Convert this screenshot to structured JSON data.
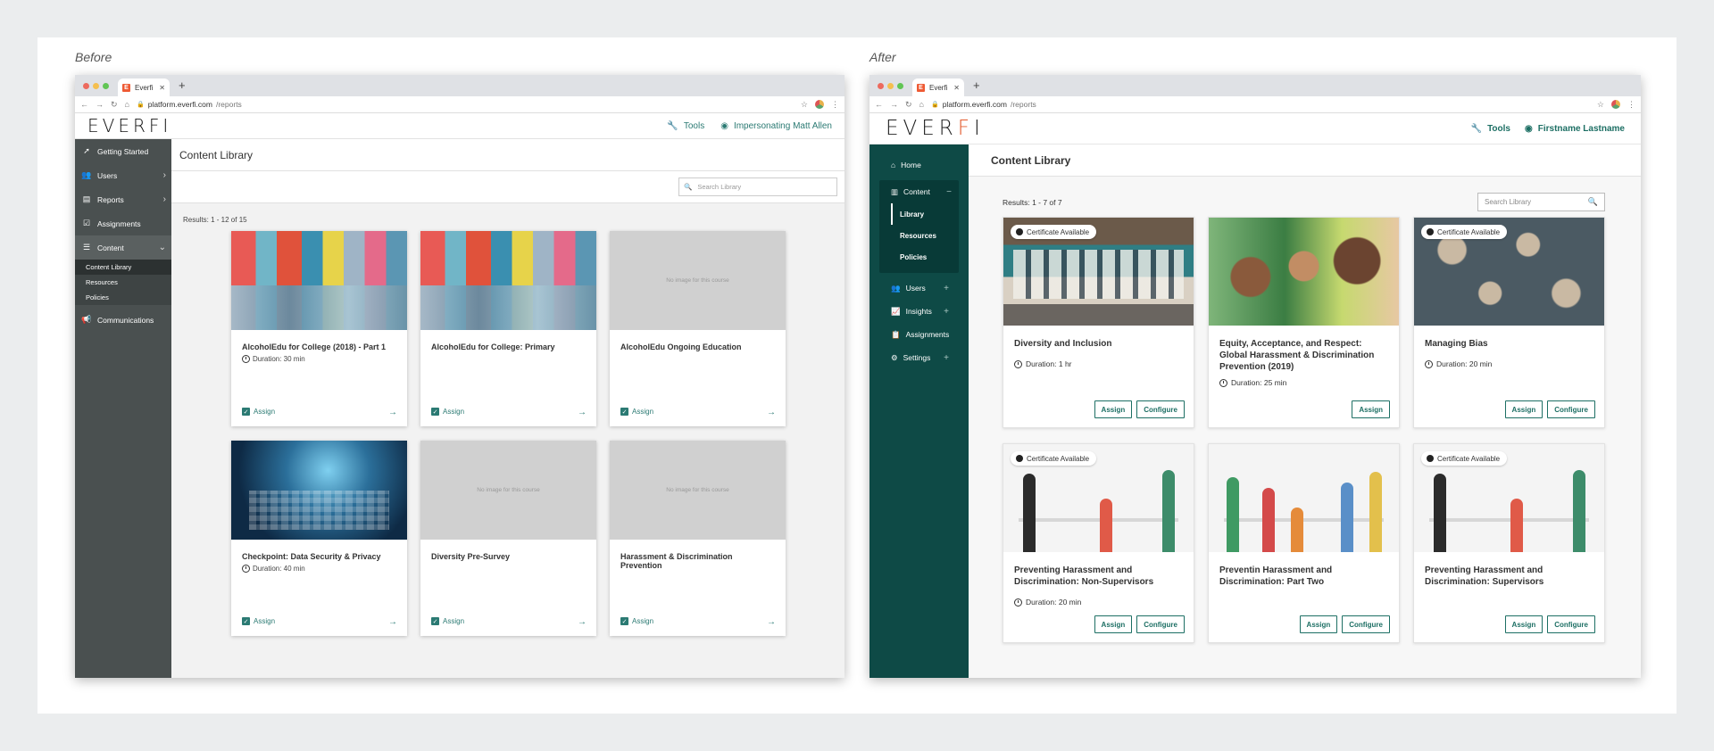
{
  "captions": {
    "before": "Before",
    "after": "After"
  },
  "browser": {
    "tab_label": "Everfi",
    "favicon_letter": "E",
    "url_host": "platform.everfi.com",
    "url_path": "/reports"
  },
  "before": {
    "logo_text": "EVERFI",
    "header": {
      "tools": "Tools",
      "user": "Impersonating Matt Allen"
    },
    "sidebar": {
      "items": [
        {
          "label": "Getting Started",
          "icon": "rocket-icon"
        },
        {
          "label": "Users",
          "icon": "users-icon"
        },
        {
          "label": "Reports",
          "icon": "reports-icon"
        },
        {
          "label": "Assignments",
          "icon": "assignments-icon"
        },
        {
          "label": "Content",
          "icon": "content-icon"
        }
      ],
      "sub_items": [
        "Content Library",
        "Resources",
        "Policies"
      ],
      "bottom_item": "Communications"
    },
    "page_title": "Content Library",
    "search_placeholder": "Search Library",
    "results": "Results: 1 - 12 of 15",
    "no_image_text": "No image for this course",
    "assign_label": "Assign",
    "cards": [
      {
        "title": "AlcoholEdu for College (2018) - Part 1",
        "duration": "Duration: 30 min"
      },
      {
        "title": "AlcoholEdu for College: Primary",
        "duration": ""
      },
      {
        "title": "AlcoholEdu Ongoing Education",
        "duration": ""
      },
      {
        "title": "Checkpoint: Data Security & Privacy",
        "duration": "Duration: 40 min"
      },
      {
        "title": "Diversity Pre-Survey",
        "duration": ""
      },
      {
        "title": "Harassment & Discrimination Prevention",
        "duration": ""
      }
    ]
  },
  "after": {
    "logo_text": "EVERFI",
    "header": {
      "tools": "Tools",
      "user": "Firstname Lastname"
    },
    "sidebar": {
      "home": "Home",
      "content": "Content",
      "content_subs": [
        "Library",
        "Resources",
        "Policies"
      ],
      "items": [
        "Users",
        "Insights",
        "Assignments",
        "Settings"
      ]
    },
    "page_title": "Content Library",
    "search_placeholder": "Search Library",
    "results": "Results: 1 - 7 of 7",
    "cert_label": "Certificate Available",
    "assign_label": "Assign",
    "configure_label": "Configure",
    "cards": [
      {
        "title": "Diversity and Inclusion",
        "duration": "Duration: 1 hr"
      },
      {
        "title": "Equity, Acceptance, and Respect: Global Harassment & Discrimination Prevention (2019)",
        "duration": "Duration: 25 min"
      },
      {
        "title": "Managing Bias",
        "duration": "Duration: 20 min"
      },
      {
        "title": "Preventing Harassment and Discrimination: Non-Supervisors",
        "duration": "Duration: 20 min"
      },
      {
        "title": "Preventin Harassment and Discrimination: Part Two",
        "duration": ""
      },
      {
        "title": "Preventing Harassment and Discrimination: Supervisors",
        "duration": ""
      }
    ]
  },
  "colors": {
    "teal": "#1d6f64",
    "dark_teal_sidebar": "#0e4a46",
    "old_sidebar": "#4a5050",
    "brand_orange": "#e45b2e"
  }
}
